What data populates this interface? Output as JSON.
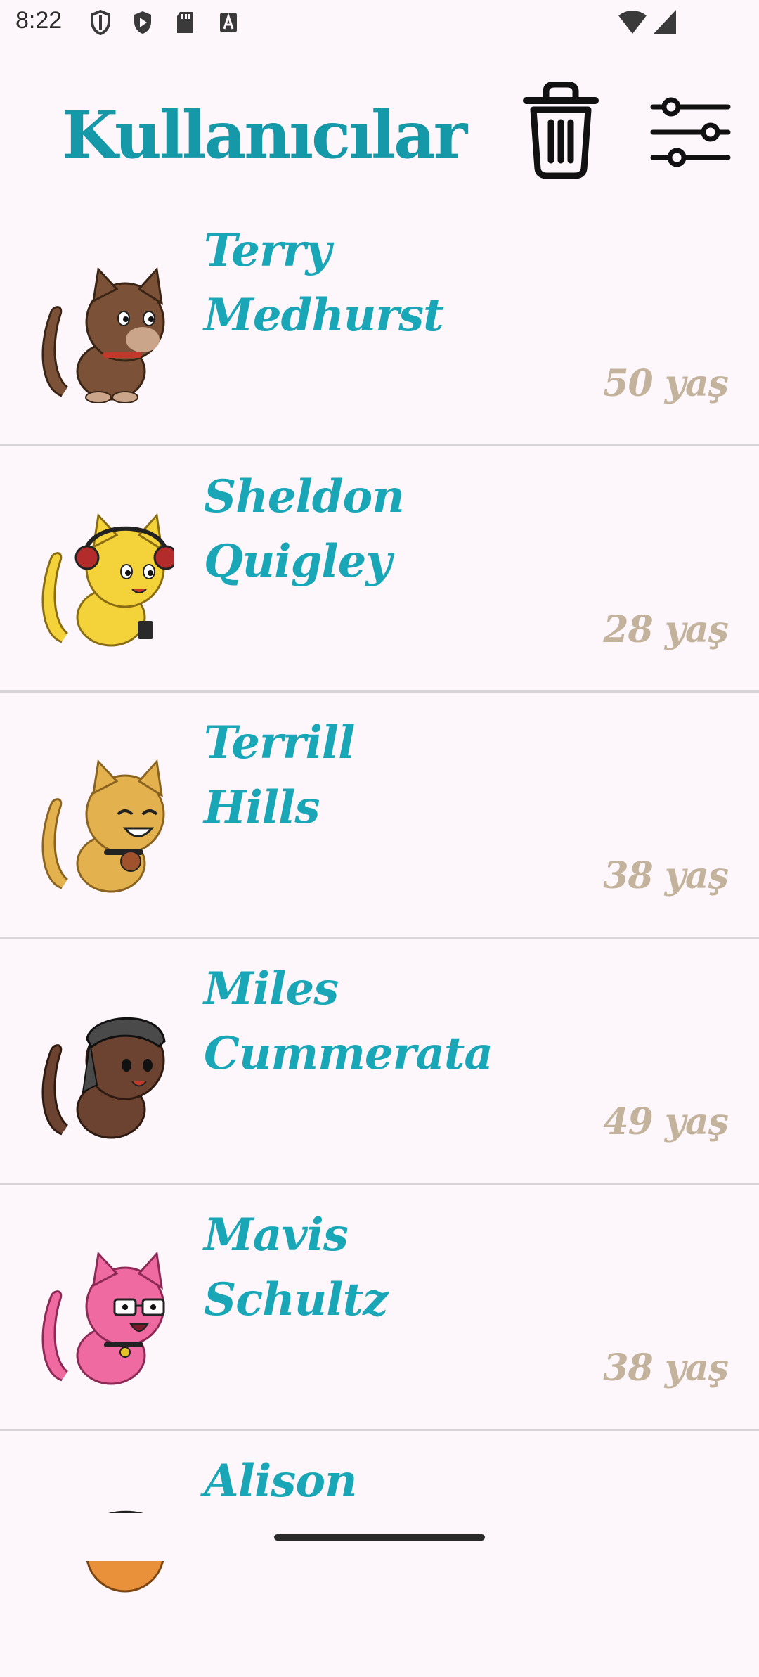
{
  "status_bar": {
    "time": "8:22"
  },
  "header": {
    "title": "Kullanıcılar"
  },
  "users": [
    {
      "first": "Terry",
      "last": "Medhurst",
      "age": "50 yaş",
      "cat_color": "#7b5237"
    },
    {
      "first": "Sheldon",
      "last": "Quigley",
      "age": "28 yaş",
      "cat_color": "#f3d23a"
    },
    {
      "first": "Terrill",
      "last": "Hills",
      "age": "38 yaş",
      "cat_color": "#e3b24f"
    },
    {
      "first": "Miles",
      "last": "Cummerata",
      "age": "49 yaş",
      "cat_color": "#6b4330"
    },
    {
      "first": "Mavis",
      "last": "Schultz",
      "age": "38 yaş",
      "cat_color": "#ef6aa0"
    },
    {
      "first": "Alison",
      "last": "",
      "age": "",
      "cat_color": "#e8913a"
    }
  ]
}
